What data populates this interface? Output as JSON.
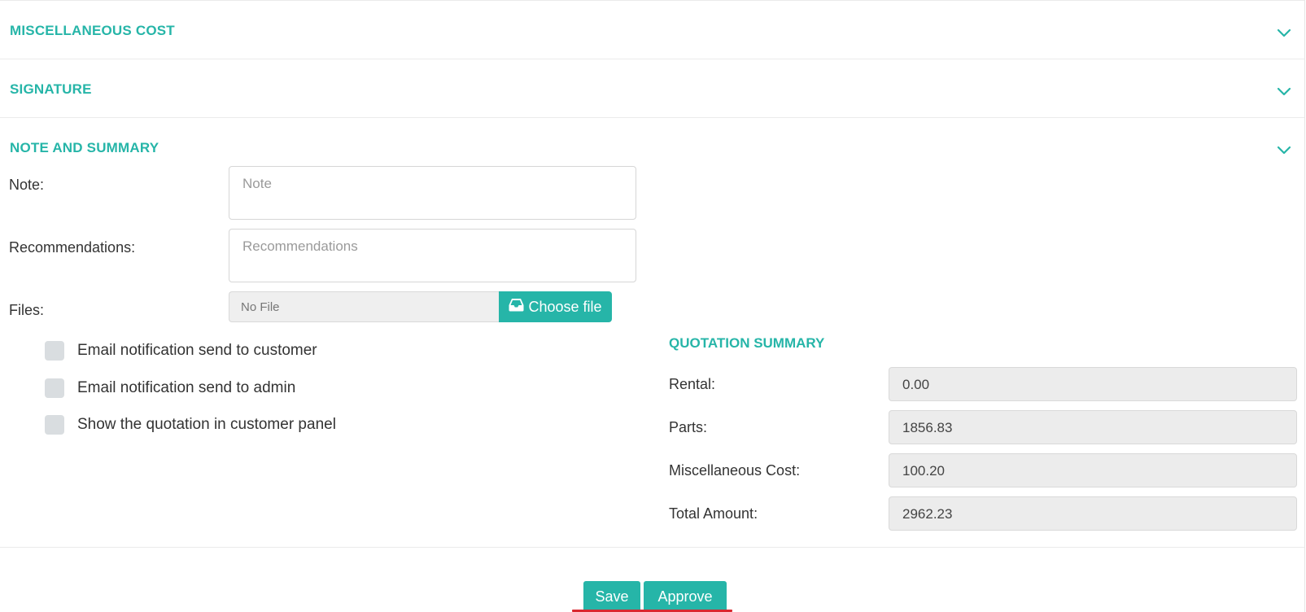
{
  "sections": [
    {
      "title": "MISCELLANEOUS COST"
    },
    {
      "title": "SIGNATURE"
    },
    {
      "title": "NOTE AND SUMMARY"
    }
  ],
  "form": {
    "note_label": "Note:",
    "note_placeholder": "Note",
    "recommendations_label": "Recommendations:",
    "recommendations_placeholder": "Recommendations",
    "files_label": "Files:",
    "file_value": "No File",
    "choose_file_label": "Choose file"
  },
  "checkboxes": [
    {
      "label": "Email notification send to customer",
      "checked": false
    },
    {
      "label": "Email notification send to admin",
      "checked": false
    },
    {
      "label": "Show the quotation in customer panel",
      "checked": false
    }
  ],
  "quotation_summary": {
    "title": "QUOTATION SUMMARY",
    "rows": [
      {
        "label": "Rental:",
        "value": "0.00"
      },
      {
        "label": "Parts:",
        "value": "1856.83"
      },
      {
        "label": "Miscellaneous Cost:",
        "value": "100.20"
      },
      {
        "label": "Total Amount:",
        "value": "2962.23"
      }
    ]
  },
  "actions": {
    "save_label": "Save",
    "approve_label": "Approve"
  },
  "colors": {
    "accent": "#26b5a8",
    "underline": "#d9272f"
  },
  "icons": {
    "chevron": "chevron-down-icon",
    "inbox": "inbox-icon"
  }
}
